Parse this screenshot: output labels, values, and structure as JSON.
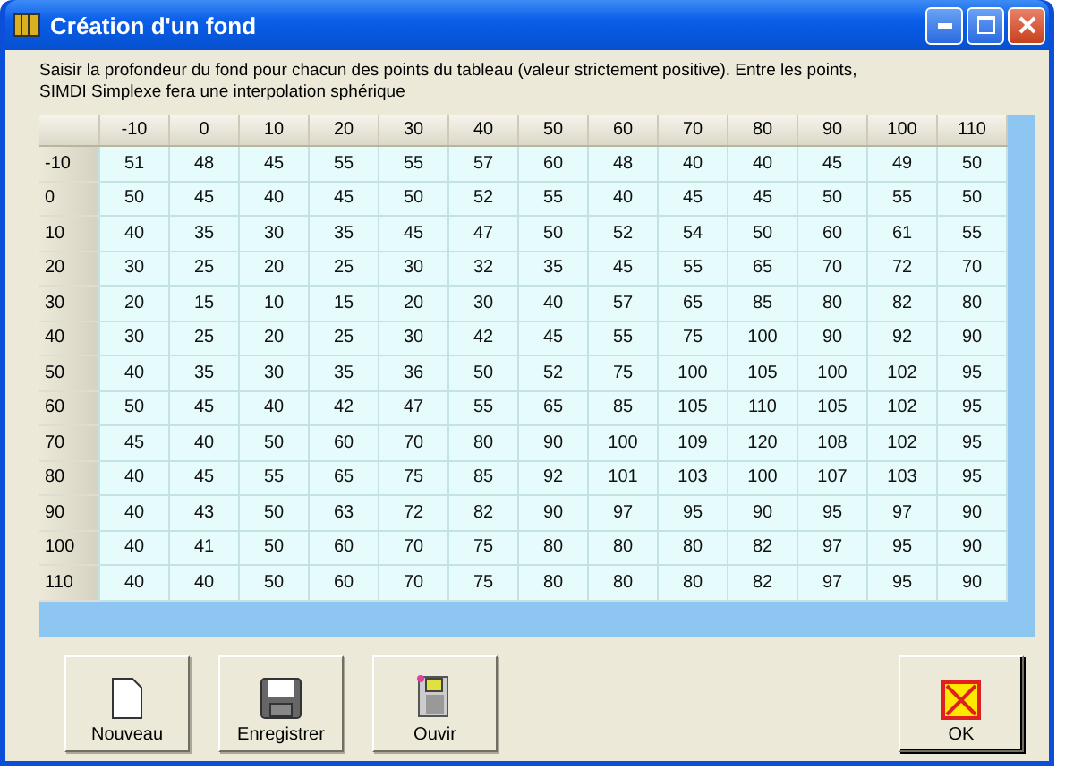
{
  "window": {
    "title": "Création d'un fond"
  },
  "instructions": "Saisir la profondeur du fond pour chacun des points du tableau (valeur strictement positive). Entre les points, SIMDI Simplexe fera une interpolation sphérique",
  "table": {
    "columns": [
      "-10",
      "0",
      "10",
      "20",
      "30",
      "40",
      "50",
      "60",
      "70",
      "80",
      "90",
      "100",
      "110"
    ],
    "rows": [
      {
        "label": "-10",
        "values": [
          "51",
          "48",
          "45",
          "55",
          "55",
          "57",
          "60",
          "48",
          "40",
          "40",
          "45",
          "49",
          "50"
        ]
      },
      {
        "label": "0",
        "values": [
          "50",
          "45",
          "40",
          "45",
          "50",
          "52",
          "55",
          "40",
          "45",
          "45",
          "50",
          "55",
          "50"
        ]
      },
      {
        "label": "10",
        "values": [
          "40",
          "35",
          "30",
          "35",
          "45",
          "47",
          "50",
          "52",
          "54",
          "50",
          "60",
          "61",
          "55"
        ]
      },
      {
        "label": "20",
        "values": [
          "30",
          "25",
          "20",
          "25",
          "30",
          "32",
          "35",
          "45",
          "55",
          "65",
          "70",
          "72",
          "70"
        ]
      },
      {
        "label": "30",
        "values": [
          "20",
          "15",
          "10",
          "15",
          "20",
          "30",
          "40",
          "57",
          "65",
          "85",
          "80",
          "82",
          "80"
        ]
      },
      {
        "label": "40",
        "values": [
          "30",
          "25",
          "20",
          "25",
          "30",
          "42",
          "45",
          "55",
          "75",
          "100",
          "90",
          "92",
          "90"
        ]
      },
      {
        "label": "50",
        "values": [
          "40",
          "35",
          "30",
          "35",
          "36",
          "50",
          "52",
          "75",
          "100",
          "105",
          "100",
          "102",
          "95"
        ]
      },
      {
        "label": "60",
        "values": [
          "50",
          "45",
          "40",
          "42",
          "47",
          "55",
          "65",
          "85",
          "105",
          "110",
          "105",
          "102",
          "95"
        ]
      },
      {
        "label": "70",
        "values": [
          "45",
          "40",
          "50",
          "60",
          "70",
          "80",
          "90",
          "100",
          "109",
          "120",
          "108",
          "102",
          "95"
        ]
      },
      {
        "label": "80",
        "values": [
          "40",
          "45",
          "55",
          "65",
          "75",
          "85",
          "92",
          "101",
          "103",
          "100",
          "107",
          "103",
          "95"
        ]
      },
      {
        "label": "90",
        "values": [
          "40",
          "43",
          "50",
          "63",
          "72",
          "82",
          "90",
          "97",
          "95",
          "90",
          "95",
          "97",
          "90"
        ]
      },
      {
        "label": "100",
        "values": [
          "40",
          "41",
          "50",
          "60",
          "70",
          "75",
          "80",
          "80",
          "80",
          "82",
          "97",
          "95",
          "90"
        ]
      },
      {
        "label": "110",
        "values": [
          "40",
          "40",
          "50",
          "60",
          "70",
          "75",
          "80",
          "80",
          "80",
          "82",
          "97",
          "95",
          "90"
        ]
      }
    ]
  },
  "buttons": [
    {
      "kind": "new",
      "label": "Nouveau"
    },
    {
      "kind": "save",
      "label": "Enregistrer"
    },
    {
      "kind": "open",
      "label": "Ouvir"
    },
    {
      "kind": "ok",
      "label": "OK"
    }
  ]
}
